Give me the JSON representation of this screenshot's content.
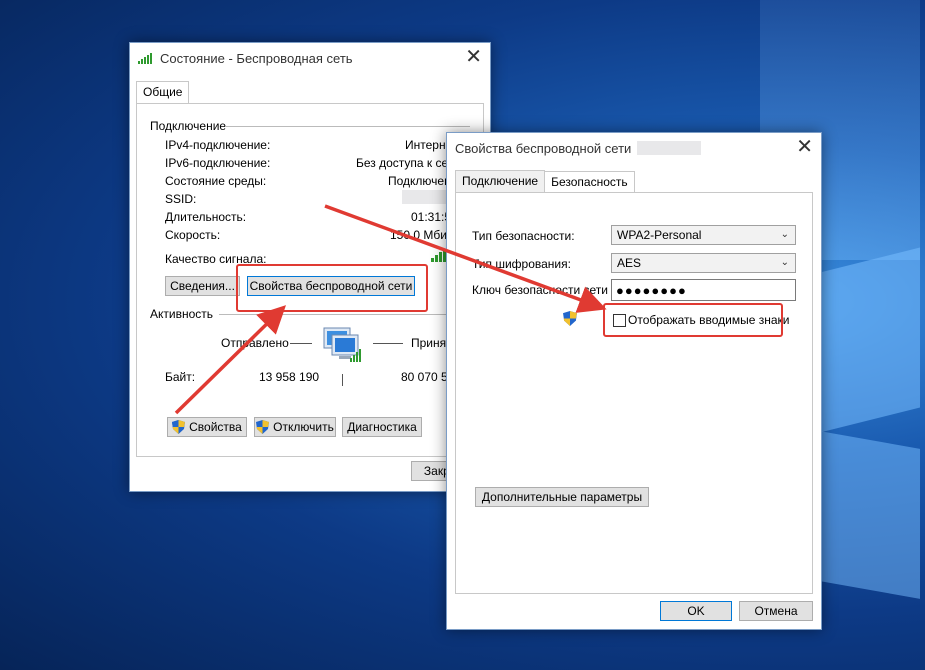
{
  "status_window": {
    "title": "Состояние - Беспроводная сеть",
    "tab": "Общие",
    "connection_header": "Подключение",
    "rows": [
      {
        "label": "IPv4-подключение:",
        "value": "Интернет"
      },
      {
        "label": "IPv6-подключение:",
        "value": "Без доступа к сети"
      },
      {
        "label": "Состояние среды:",
        "value": "Подключено"
      },
      {
        "label": "SSID:",
        "value": ""
      },
      {
        "label": "Длительность:",
        "value": "01:31:55"
      },
      {
        "label": "Скорость:",
        "value": "150.0 Мбит/с"
      }
    ],
    "signal_label": "Качество сигнала:",
    "details_button": "Сведения...",
    "wireless_props_button": "Свойства беспроводной сети",
    "activity_header": "Активность",
    "sent_label": "Отправлено",
    "received_label": "Принято",
    "bytes_label": "Байт:",
    "bytes_sent": "13 958 190",
    "bytes_received": "80 070 506",
    "properties_button": "Свойства",
    "disconnect_button": "Отключить",
    "diagnostics_button": "Диагностика",
    "close_button": "Закрыть"
  },
  "props_window": {
    "title": "Свойства беспроводной сети",
    "tabs": [
      "Подключение",
      "Безопасность"
    ],
    "security_type_label": "Тип безопасности:",
    "security_type_value": "WPA2-Personal",
    "encryption_label": "Тип шифрования:",
    "encryption_value": "AES",
    "key_label": "Ключ безопасности сети",
    "key_value": "●●●●●●●●",
    "show_chars_label": "Отображать вводимые знаки",
    "advanced_button": "Дополнительные параметры",
    "ok_button": "OK",
    "cancel_button": "Отмена"
  },
  "colors": {
    "annotation_red": "#e03a32",
    "accent_blue": "#0078d7"
  }
}
